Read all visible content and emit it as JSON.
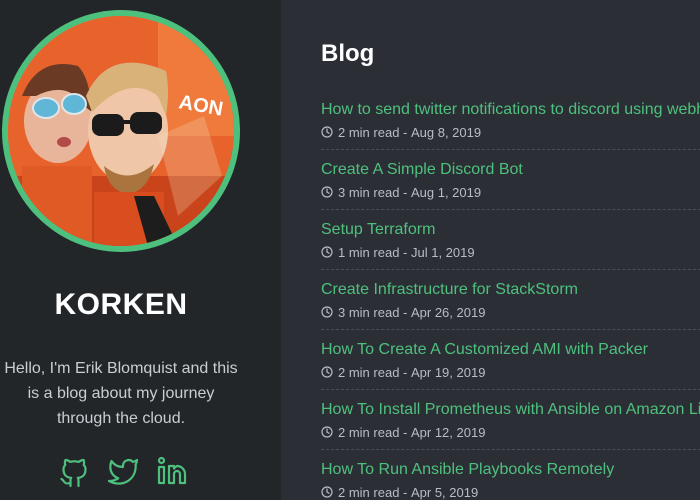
{
  "sidebar": {
    "site_title": "KORKEN",
    "bio": "Hello, I'm Erik Blomquist and this is a blog about my journey through the cloud.",
    "socials": [
      {
        "icon": "github-icon"
      },
      {
        "icon": "twitter-icon"
      },
      {
        "icon": "linkedin-icon"
      }
    ]
  },
  "main": {
    "heading": "Blog",
    "posts": [
      {
        "title": "How to send twitter notifications to discord using webhooks",
        "read_time": "2 min read",
        "date": "Aug 8, 2019"
      },
      {
        "title": "Create A Simple Discord Bot",
        "read_time": "3 min read",
        "date": "Aug 1, 2019"
      },
      {
        "title": "Setup Terraform",
        "read_time": "1 min read",
        "date": "Jul 1, 2019"
      },
      {
        "title": "Create Infrastructure for StackStorm",
        "read_time": "3 min read",
        "date": "Apr 26, 2019"
      },
      {
        "title": "How To Create A Customized AMI with Packer",
        "read_time": "2 min read",
        "date": "Apr 19, 2019"
      },
      {
        "title": "How To Install Prometheus with Ansible on Amazon Linux",
        "read_time": "2 min read",
        "date": "Apr 12, 2019"
      },
      {
        "title": "How To Run Ansible Playbooks Remotely",
        "read_time": "2 min read",
        "date": "Apr 5, 2019"
      }
    ]
  },
  "colors": {
    "accent": "#4ec07e",
    "sidebar_bg": "#232629",
    "main_bg": "#2b2f35"
  }
}
